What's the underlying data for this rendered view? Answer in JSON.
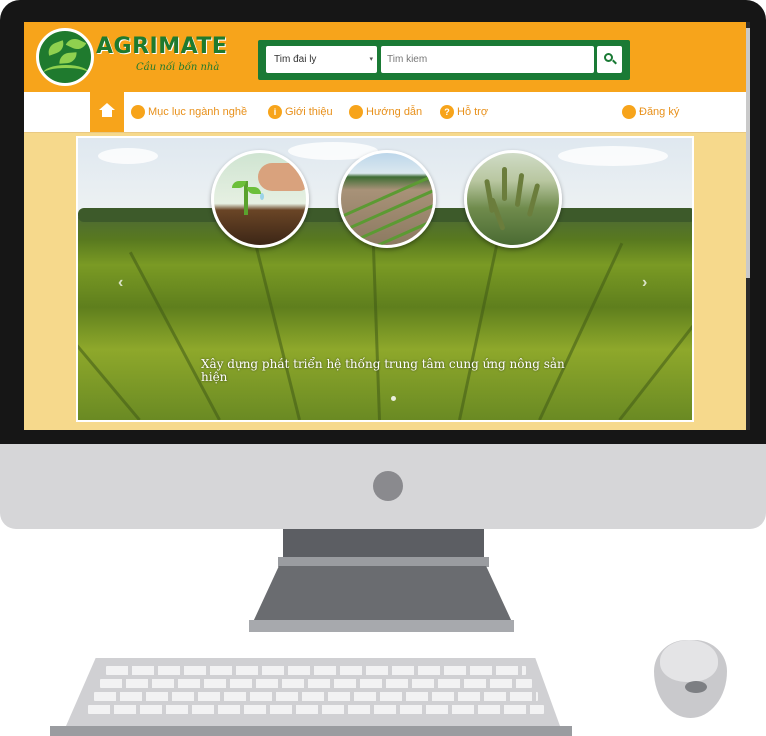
{
  "site": {
    "brand": "AGRIMATE",
    "tagline": "Cầu nối bốn nhà",
    "brand_color": "#1a7a35",
    "accent_color": "#f7a41b"
  },
  "search": {
    "select_value": "Tim đai ly",
    "input_placeholder": "Tim kiem",
    "button_icon": "search-icon"
  },
  "nav": {
    "home_icon": "home-icon",
    "items": [
      {
        "label": "Mục lục ngành nghề",
        "icon": "book-icon"
      },
      {
        "label": "Giới thiệu",
        "icon": "info-icon"
      },
      {
        "label": "Hướng dẫn",
        "icon": "guide-icon"
      },
      {
        "label": "Hỗ trợ",
        "icon": "help-icon"
      }
    ],
    "register": {
      "label": "Đăng ký",
      "icon": "user-icon"
    }
  },
  "slider": {
    "caption": "Xây dựng phát triển hệ thống trung tâm cung ứng nông sản hiện",
    "prev_icon": "chevron-left-icon",
    "next_icon": "chevron-right-icon"
  },
  "glyphs": {
    "prev": "‹",
    "next": "›",
    "caret": "▾",
    "info": "i",
    "help": "?"
  }
}
